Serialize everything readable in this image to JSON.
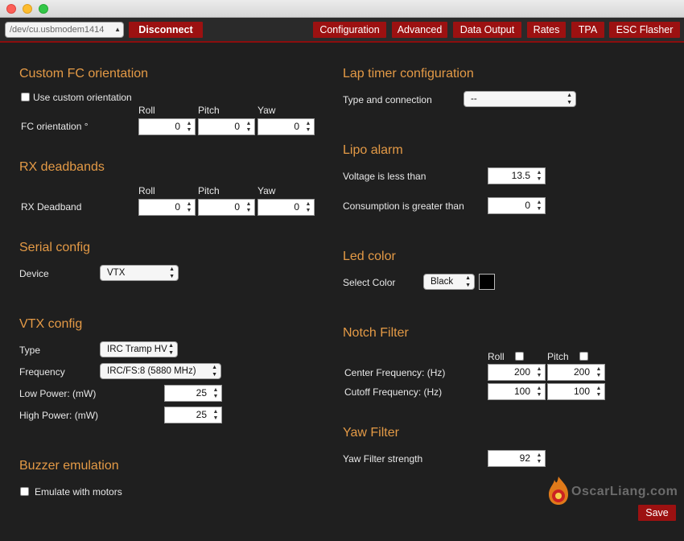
{
  "toolbar": {
    "port": "/dev/cu.usbmodem1414",
    "disconnect": "Disconnect",
    "tabs": [
      "Configuration",
      "Advanced",
      "Data Output",
      "Rates",
      "TPA",
      "ESC Flasher"
    ]
  },
  "fc": {
    "title": "Custom FC orientation",
    "use_custom": "Use custom orientation",
    "roll": "Roll",
    "pitch": "Pitch",
    "yaw": "Yaw",
    "label": "FC orientation °",
    "values": [
      "0",
      "0",
      "0"
    ]
  },
  "rx": {
    "title": "RX deadbands",
    "roll": "Roll",
    "pitch": "Pitch",
    "yaw": "Yaw",
    "label": "RX Deadband",
    "values": [
      "0",
      "0",
      "0"
    ]
  },
  "serial": {
    "title": "Serial config",
    "device_label": "Device",
    "device": "VTX"
  },
  "vtx": {
    "title": "VTX config",
    "type_label": "Type",
    "type": "IRC Tramp HV",
    "freq_label": "Frequency",
    "freq": "IRC/FS:8 (5880 MHz)",
    "low_label": "Low Power: (mW)",
    "low": "25",
    "high_label": "High Power: (mW)",
    "high": "25"
  },
  "buzzer": {
    "title": "Buzzer emulation",
    "emulate": "Emulate with motors"
  },
  "lap": {
    "title": "Lap timer configuration",
    "label": "Type and connection",
    "value": "--"
  },
  "lipo": {
    "title": "Lipo alarm",
    "voltage_label": "Voltage is less than",
    "voltage": "13.5",
    "consumption_label": "Consumption is greater than",
    "consumption": "0"
  },
  "led": {
    "title": "Led color",
    "label": "Select Color",
    "value": "Black",
    "swatch_color": "#000000"
  },
  "notch": {
    "title": "Notch Filter",
    "roll": "Roll",
    "pitch": "Pitch",
    "center_label": "Center Frequency: (Hz)",
    "center_roll": "200",
    "center_pitch": "200",
    "cutoff_label": "Cutoff Frequency: (Hz)",
    "cutoff_roll": "100",
    "cutoff_pitch": "100"
  },
  "yaw": {
    "title": "Yaw Filter",
    "label": "Yaw Filter strength",
    "value": "92"
  },
  "logo": "OscarLiang.com",
  "save": "Save"
}
